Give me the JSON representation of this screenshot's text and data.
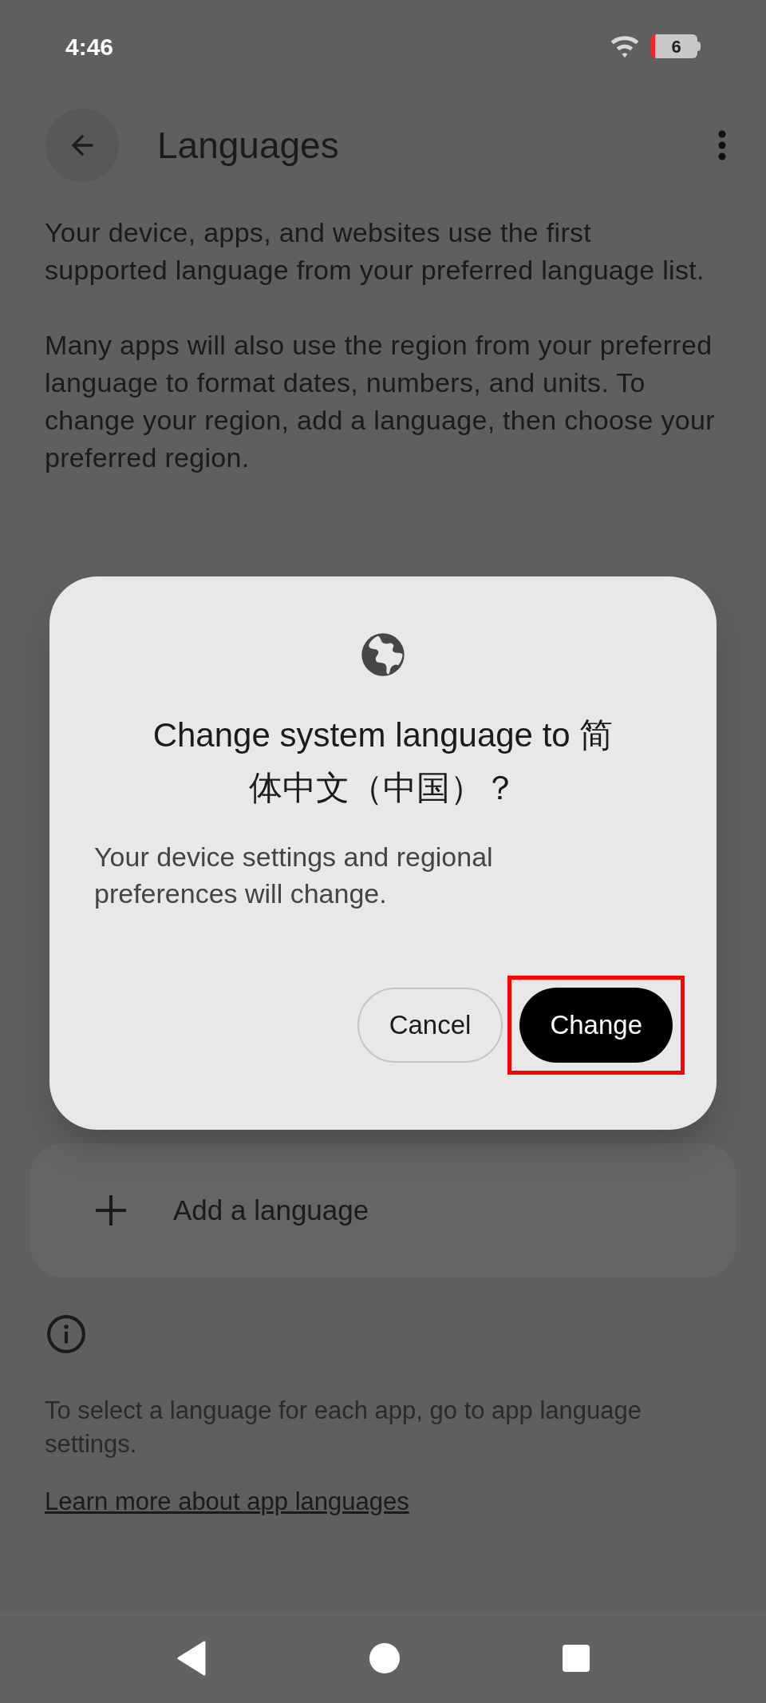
{
  "status_bar": {
    "time": "4:46",
    "battery": "6"
  },
  "header": {
    "title": "Languages"
  },
  "intro": [
    "Your device, apps, and websites use the first supported language from your preferred language list.",
    "Many apps will also use the region from your preferred language to format dates, numbers, and units. To change your region, add a language, then choose your preferred region."
  ],
  "add_language": {
    "label": "Add a language"
  },
  "footer": {
    "note": "To select a language for each app, go to app language settings.",
    "link": "Learn more about app languages"
  },
  "dialog": {
    "title": "Change system language to 简体中文（中国）？",
    "message": "Your device settings and regional preferences will change.",
    "buttons": [
      {
        "label": "Cancel",
        "kind": "outlined",
        "highlighted": false
      },
      {
        "label": "Change",
        "kind": "filled",
        "highlighted": true
      }
    ]
  }
}
